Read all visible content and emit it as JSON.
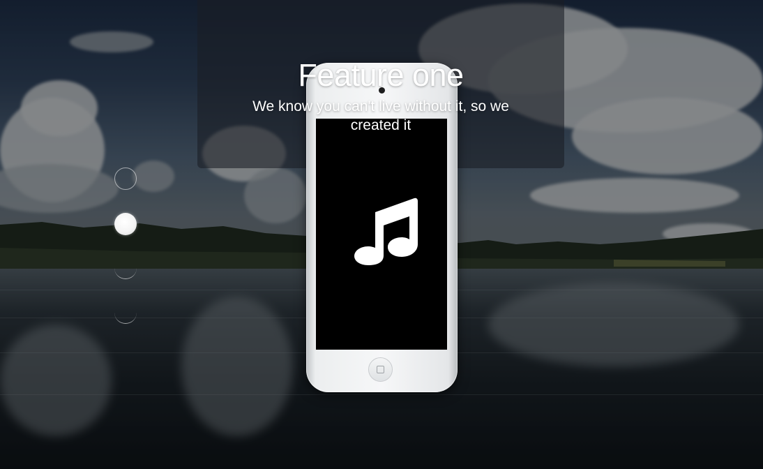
{
  "hero": {
    "title": "Feature one",
    "subtitle": "We know you can't live without it, so we created it"
  },
  "phone": {
    "screen_icon": "music-note-icon",
    "screen_color": "#000000",
    "body_color": "#f2f3f4"
  },
  "pagination": {
    "active_index": 2,
    "total": 4
  },
  "colors": {
    "text": "#ffffff",
    "panel_overlay": "rgba(26,30,36,0.58)"
  }
}
